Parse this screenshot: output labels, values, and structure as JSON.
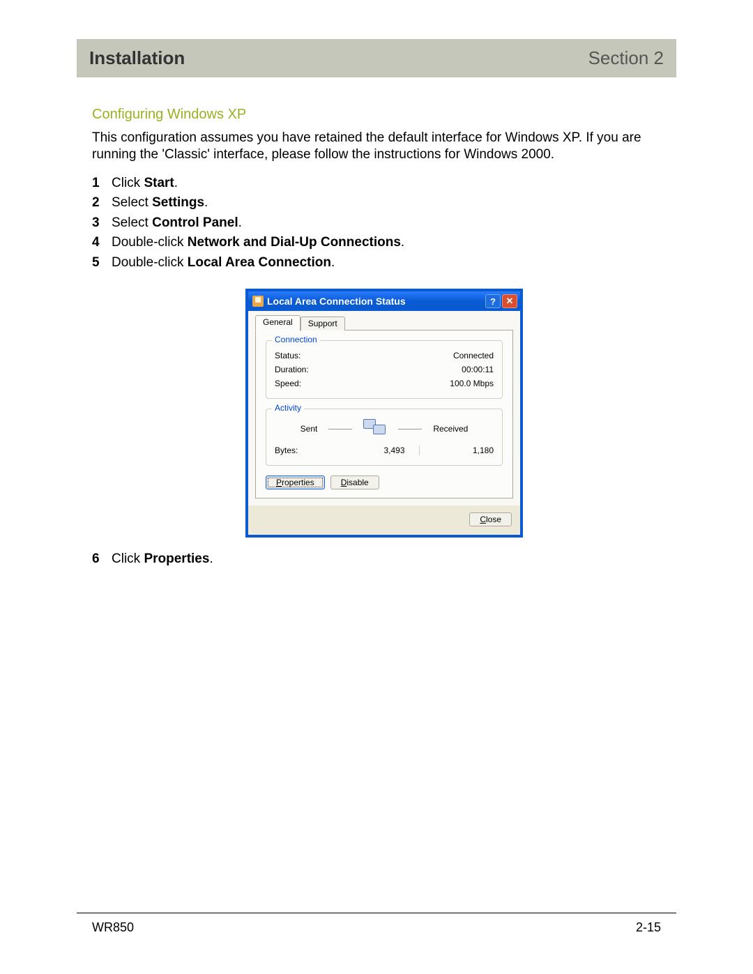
{
  "header": {
    "left": "Installation",
    "right": "Section 2"
  },
  "subHeading": "Configuring Windows XP",
  "intro": "This configuration assumes you have retained the default interface for Windows XP. If you are running the 'Classic' interface, please follow the instructions for Windows 2000.",
  "steps": [
    {
      "num": "1",
      "pre": "Click ",
      "bold": "Start",
      "post": "."
    },
    {
      "num": "2",
      "pre": "Select ",
      "bold": "Settings",
      "post": "."
    },
    {
      "num": "3",
      "pre": "Select ",
      "bold": "Control Panel",
      "post": "."
    },
    {
      "num": "4",
      "pre": "Double-click ",
      "bold": "Network and Dial-Up Connections",
      "post": "."
    },
    {
      "num": "5",
      "pre": "Double-click ",
      "bold": "Local Area Connection",
      "post": "."
    }
  ],
  "step6": {
    "num": "6",
    "pre": "Click ",
    "bold": "Properties",
    "post": "."
  },
  "dialog": {
    "title": "Local Area Connection Status",
    "helpGlyph": "?",
    "closeGlyph": "✕",
    "tabs": {
      "general": "General",
      "support": "Support"
    },
    "connection": {
      "label": "Connection",
      "statusLabel": "Status:",
      "statusValue": "Connected",
      "durationLabel": "Duration:",
      "durationValue": "00:00:11",
      "speedLabel": "Speed:",
      "speedValue": "100.0 Mbps"
    },
    "activity": {
      "label": "Activity",
      "sent": "Sent",
      "received": "Received",
      "bytesLabel": "Bytes:",
      "bytesSent": "3,493",
      "bytesReceived": "1,180"
    },
    "buttons": {
      "properties": "Properties",
      "propertiesU": "P",
      "disable": "Disable",
      "disableU": "D",
      "close": "Close",
      "closeU": "C"
    }
  },
  "footer": {
    "left": "WR850",
    "right": "2-15"
  }
}
